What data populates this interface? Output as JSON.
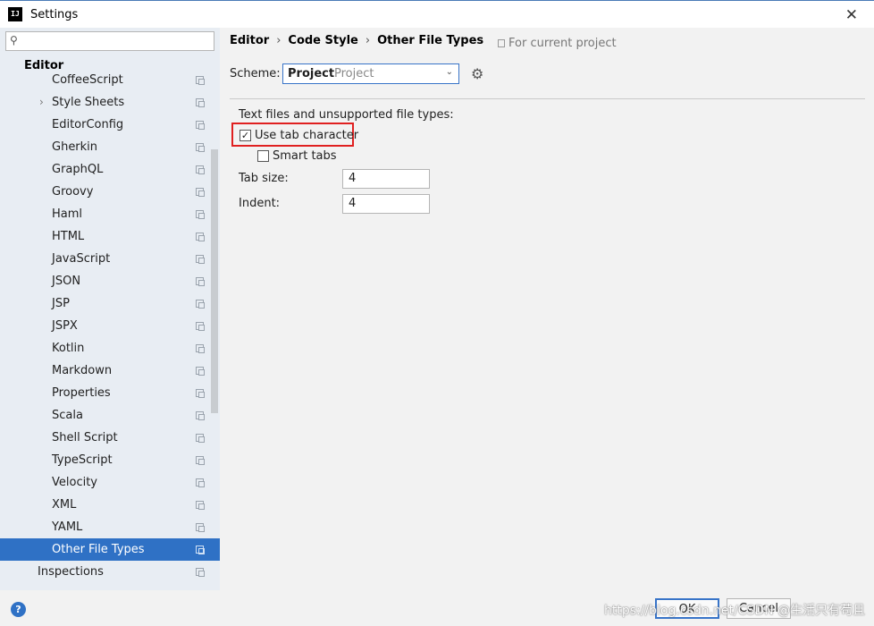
{
  "window": {
    "title": "Settings",
    "app_icon": "IJ"
  },
  "search": {
    "placeholder": ""
  },
  "sidebar": {
    "section_title": "Editor",
    "items": [
      {
        "label": "CoffeeScript"
      },
      {
        "label": "Style Sheets"
      },
      {
        "label": "EditorConfig"
      },
      {
        "label": "Gherkin"
      },
      {
        "label": "GraphQL"
      },
      {
        "label": "Groovy"
      },
      {
        "label": "Haml"
      },
      {
        "label": "HTML"
      },
      {
        "label": "JavaScript"
      },
      {
        "label": "JSON"
      },
      {
        "label": "JSP"
      },
      {
        "label": "JSPX"
      },
      {
        "label": "Kotlin"
      },
      {
        "label": "Markdown"
      },
      {
        "label": "Properties"
      },
      {
        "label": "Scala"
      },
      {
        "label": "Shell Script"
      },
      {
        "label": "TypeScript"
      },
      {
        "label": "Velocity"
      },
      {
        "label": "XML"
      },
      {
        "label": "YAML"
      },
      {
        "label": "Other File Types"
      },
      {
        "label": "Inspections"
      }
    ]
  },
  "breadcrumb": {
    "items": [
      "Editor",
      "Code Style",
      "Other File Types"
    ],
    "scope": "For current project"
  },
  "scheme": {
    "label": "Scheme:",
    "value": "Project",
    "hint": "Project"
  },
  "panel": {
    "description": "Text files and unsupported file types:",
    "use_tab_character": {
      "label": "Use tab character",
      "checked": true
    },
    "smart_tabs": {
      "label": "Smart tabs",
      "checked": false
    },
    "tab_size": {
      "label": "Tab size:",
      "value": "4"
    },
    "indent": {
      "label": "Indent:",
      "value": "4"
    }
  },
  "footer": {
    "help": "?",
    "ok": "OK",
    "cancel": "Cancel",
    "watermark": "https://blog.csdn.net/CSDN @生活只有苟且"
  },
  "colors": {
    "selection": "#2f71c5",
    "highlight": "#e02020",
    "focus_border": "#3874c8"
  }
}
